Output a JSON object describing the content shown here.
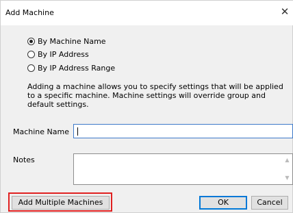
{
  "dialog": {
    "title": "Add Machine",
    "close_glyph": "✕"
  },
  "mode": {
    "options": [
      {
        "label": "By Machine Name",
        "checked": true
      },
      {
        "label": "By IP Address",
        "checked": false
      },
      {
        "label": "By IP Address Range",
        "checked": false
      }
    ]
  },
  "description": "Adding a machine allows you to specify settings that will be applied to a specific machine.  Machine settings will override group and default settings.",
  "machine_name": {
    "label": "Machine Name",
    "value": ""
  },
  "notes": {
    "label": "Notes",
    "value": ""
  },
  "buttons": {
    "add_multiple": "Add Multiple Machines",
    "ok": "OK",
    "cancel": "Cancel"
  },
  "colors": {
    "highlight": "#e02020",
    "focus_border": "#3c78c8",
    "default_button_border": "#0078d7"
  }
}
